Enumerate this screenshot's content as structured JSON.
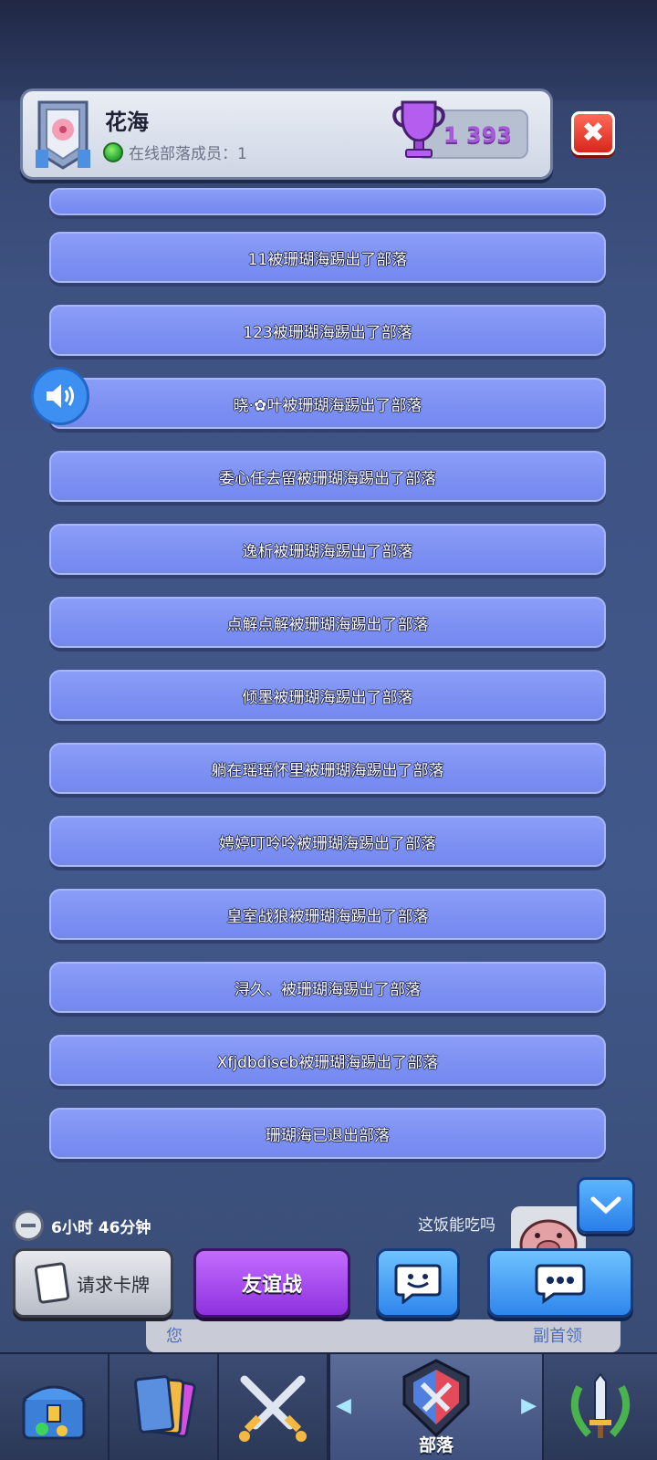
{
  "header": {
    "clan_name": "花海",
    "online_label": "在线部落成员：1",
    "trophies": "1 393",
    "close_label": "✖"
  },
  "messages": [
    "11被珊瑚海踢出了部落",
    "123被珊瑚海踢出了部落",
    "晓·✿叶被珊瑚海踢出了部落",
    "委心任去留被珊瑚海踢出了部落",
    "逸析被珊瑚海踢出了部落",
    "点解点解被珊瑚海踢出了部落",
    "倾墨被珊瑚海踢出了部落",
    "躺在瑶瑶怀里被珊瑚海踢出了部落",
    "娉婷叮呤呤被珊瑚海踢出了部落",
    "皇室战狼被珊瑚海踢出了部落",
    "浔久、被珊瑚海踢出了部落",
    "Xfjdbdiseb被珊瑚海踢出了部落",
    "珊瑚海已退出部落"
  ],
  "footer": {
    "timer": "6小时 46分钟",
    "chat_preview": "这饭能吃吗",
    "request_card_label": "请求卡牌",
    "friendly_battle_label": "友谊战",
    "role_you": "您",
    "role_other": "副首领"
  },
  "nav": {
    "active_label": "部落",
    "items": [
      "shop",
      "cards",
      "battle",
      "clan",
      "events"
    ]
  },
  "colors": {
    "message_bg": "#7f93f4",
    "battle_button": "#a44ef0",
    "chat_button": "#3c93f0",
    "close_button": "#e33a2c"
  }
}
